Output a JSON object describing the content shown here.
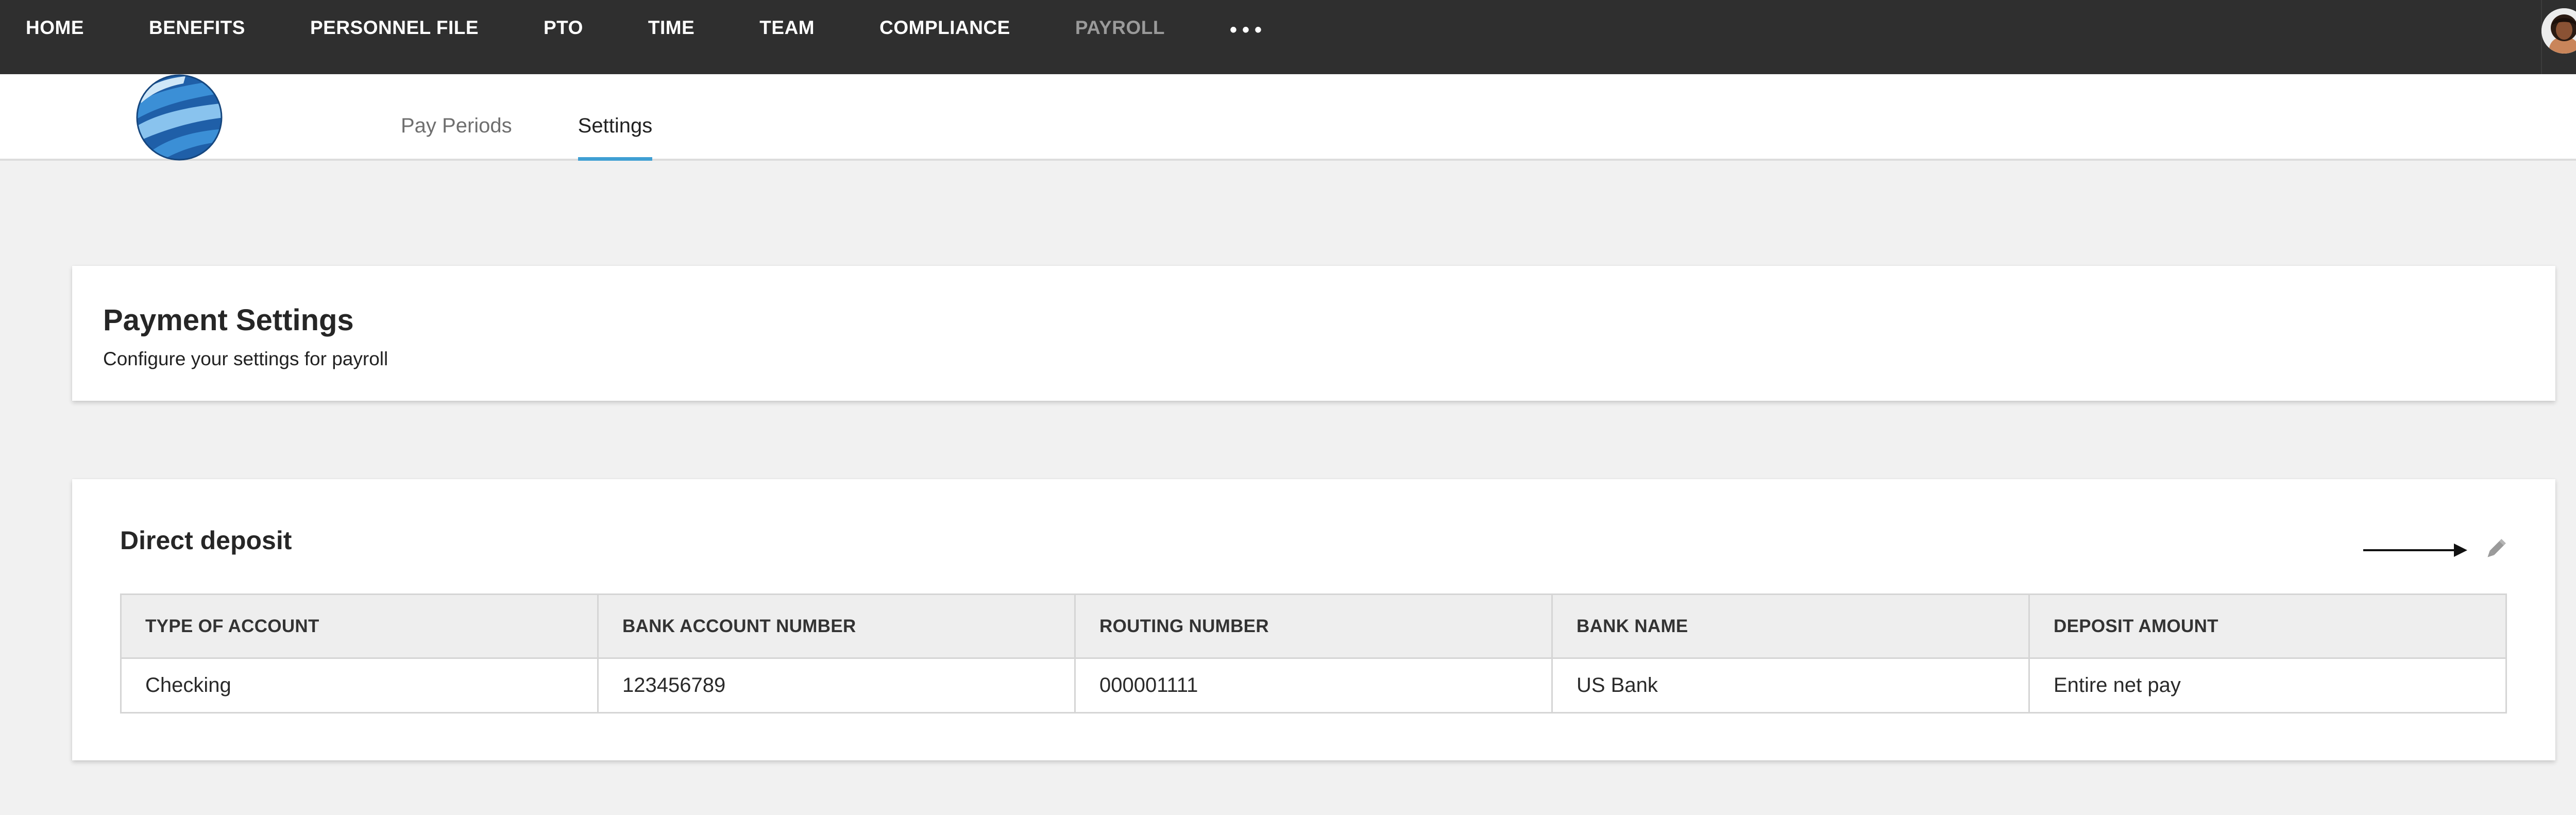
{
  "nav": {
    "items": [
      "HOME",
      "BENEFITS",
      "PERSONNEL FILE",
      "PTO",
      "TIME",
      "TEAM",
      "COMPLIANCE",
      "PAYROLL"
    ],
    "active": "PAYROLL",
    "more_label": "•••"
  },
  "tabs": [
    {
      "label": "Pay Periods",
      "selected": false
    },
    {
      "label": "Settings",
      "selected": true
    }
  ],
  "settings_card": {
    "title": "Payment Settings",
    "subtitle": "Configure your settings for payroll"
  },
  "direct_deposit": {
    "title": "Direct deposit",
    "columns": [
      "TYPE OF ACCOUNT",
      "BANK ACCOUNT NUMBER",
      "ROUTING NUMBER",
      "BANK NAME",
      "DEPOSIT AMOUNT"
    ],
    "rows": [
      [
        "Checking",
        "123456789",
        "000001111",
        "US Bank",
        "Entire net pay"
      ]
    ]
  },
  "colors": {
    "nav_bg": "#2f2f2f",
    "tab_underline": "#3f9fd3",
    "page_bg": "#f1f1f1"
  }
}
